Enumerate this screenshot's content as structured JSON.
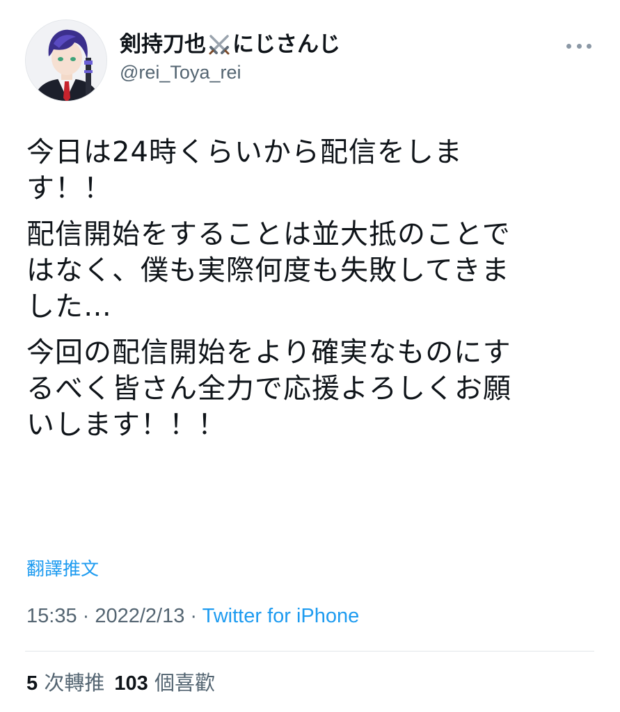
{
  "author": {
    "display_name_prefix": "剣持刀也",
    "display_name_icon": "crossed-swords-icon",
    "display_name_suffix": "にじさんじ",
    "handle": "@rei_Toya_rei",
    "avatar": "avatar-image"
  },
  "menu": {
    "icon": "more-horizontal-icon"
  },
  "tweet": {
    "paragraphs": [
      "今日は24時くらいから配信をしま\nす！！",
      "配信開始をすることは並大抵のことで\nはなく、僕も実際何度も失敗してきま\nした…",
      "今回の配信開始をより確実なものにす\nるべく皆さん全力で応援よろしくお願\nいします！！！"
    ]
  },
  "translate_label": "翻譯推文",
  "meta": {
    "time": "15:35",
    "separator": " · ",
    "date": "2022/2/13",
    "source": "Twitter for iPhone"
  },
  "stats": {
    "retweets_count": "5",
    "retweets_label": " 次轉推",
    "likes_count": "103",
    "likes_label": " 個喜歡"
  },
  "colors": {
    "text": "#0f1419",
    "secondary": "#536471",
    "link": "#1d9bf0",
    "divider": "#e1e6ea"
  }
}
